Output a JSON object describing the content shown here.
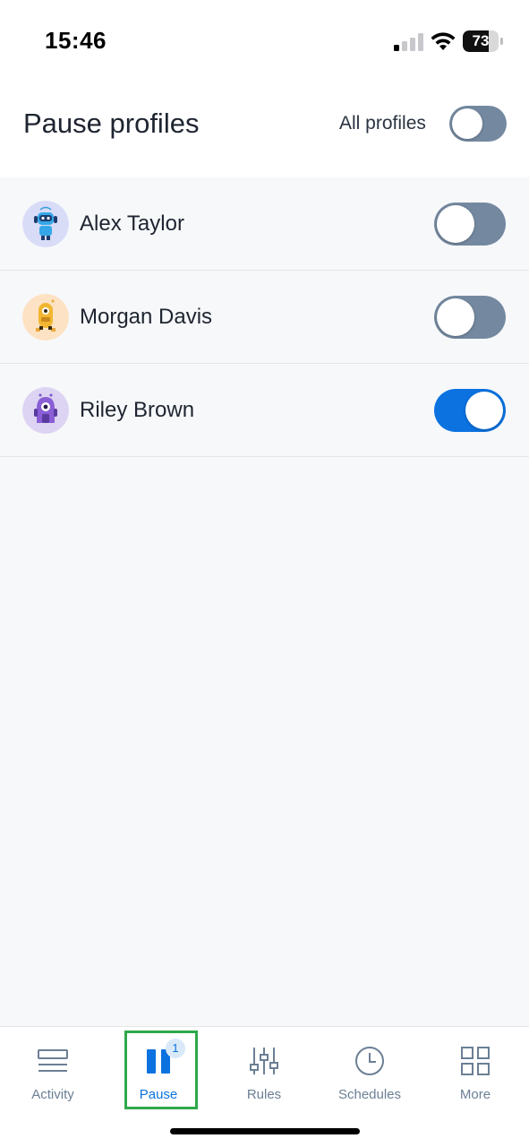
{
  "status_bar": {
    "time": "15:46",
    "battery_level": "73",
    "battery_fraction": 0.73
  },
  "header": {
    "title": "Pause profiles",
    "all_profiles_label": "All profiles",
    "all_profiles_on": false
  },
  "profiles": [
    {
      "name": "Alex Taylor",
      "avatar": "robot-blue-avatar",
      "paused": false
    },
    {
      "name": "Morgan Davis",
      "avatar": "robot-yellow-avatar",
      "paused": false
    },
    {
      "name": "Riley Brown",
      "avatar": "robot-purple-avatar",
      "paused": true
    }
  ],
  "tabbar": {
    "tabs": [
      {
        "label": "Activity",
        "icon": "activity-list-icon",
        "active": false
      },
      {
        "label": "Pause",
        "icon": "pause-icon",
        "active": true,
        "badge": "1"
      },
      {
        "label": "Rules",
        "icon": "rules-sliders-icon",
        "active": false
      },
      {
        "label": "Schedules",
        "icon": "clock-icon",
        "active": false
      },
      {
        "label": "More",
        "icon": "grid-icon",
        "active": false
      }
    ]
  },
  "colors": {
    "accent": "#0b72e0",
    "toggle_off": "#7489a0",
    "highlight": "#2ea84a",
    "tab_inactive": "#6b7f94"
  }
}
